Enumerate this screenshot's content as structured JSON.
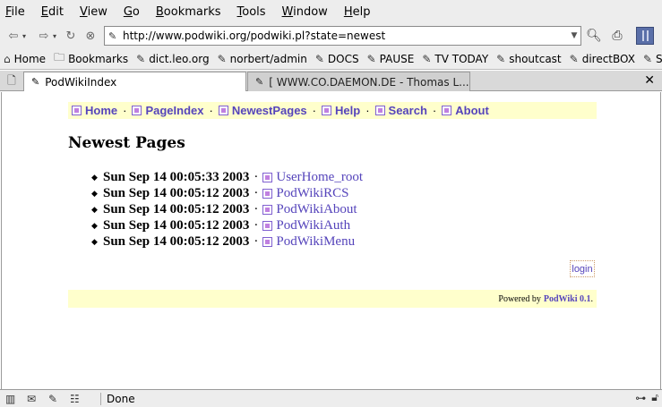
{
  "menu": [
    "File",
    "Edit",
    "View",
    "Go",
    "Bookmarks",
    "Tools",
    "Window",
    "Help"
  ],
  "menu_underline_first": true,
  "url": "http://www.podwiki.org/podwiki.pl?state=newest",
  "bookmarks": [
    "Home",
    "Bookmarks",
    "dict.leo.org",
    "norbert/admin",
    "DOCS",
    "PAUSE",
    "TV TODAY",
    "shoutcast",
    "directBOX",
    "SC"
  ],
  "tabs": {
    "active": "PodWikiIndex",
    "inactive": "[ WWW.CO.DAEMON.DE - Thomas L..."
  },
  "page": {
    "nav": [
      "Home",
      "PageIndex",
      "NewestPages",
      "Help",
      "Search",
      "About"
    ],
    "nav_separator": "·",
    "title": "Newest Pages",
    "entries": [
      {
        "date": "Sun Sep 14 00:05:33 2003",
        "page": "UserHome_root"
      },
      {
        "date": "Sun Sep 14 00:05:12 2003",
        "page": "PodWikiRCS"
      },
      {
        "date": "Sun Sep 14 00:05:12 2003",
        "page": "PodWikiAbout"
      },
      {
        "date": "Sun Sep 14 00:05:12 2003",
        "page": "PodWikiAuth"
      },
      {
        "date": "Sun Sep 14 00:05:12 2003",
        "page": "PodWikiMenu"
      }
    ],
    "entry_separator": "·",
    "login_label": "login",
    "footer_prefix": "Powered by",
    "footer_link": "PodWiki 0.1",
    "footer_suffix": "."
  },
  "status": {
    "text": "Done"
  },
  "colors": {
    "link": "#5544bb",
    "highlight_bg": "#ffffcc",
    "chrome_bg": "#ededed"
  }
}
